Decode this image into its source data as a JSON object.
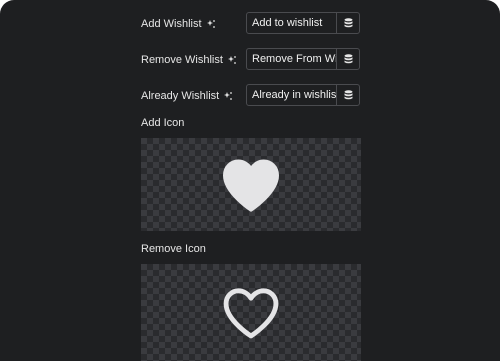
{
  "rows": [
    {
      "label": "Add Wishlist",
      "value": "Add to wishlist"
    },
    {
      "label": "Remove Wishlist",
      "value": "Remove From Wishlist"
    },
    {
      "label": "Already Wishlist",
      "value": "Already in wishlist"
    }
  ],
  "add_icon_label": "Add Icon",
  "remove_icon_label": "Remove Icon",
  "icons": {
    "add": "heart-filled-icon",
    "remove": "heart-outline-icon",
    "dynamic": "sparkle-icon",
    "database": "database-icon"
  },
  "colors": {
    "panel_bg": "#1e1f21",
    "text": "#e6e6e6",
    "heart": "#e4e4e6"
  }
}
